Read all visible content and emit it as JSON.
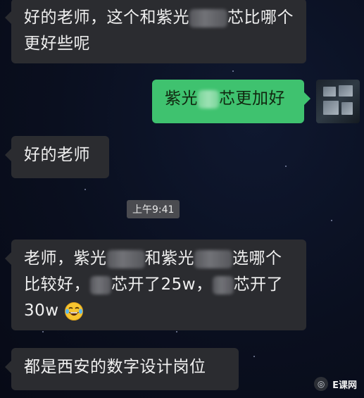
{
  "messages": [
    {
      "side": "left",
      "line1_a": "好的老师，这个和紫光",
      "line1_b": "芯比哪个",
      "line2": "更好些呢"
    },
    {
      "side": "right",
      "text_a": "紫光",
      "text_b": "芯更加好"
    },
    {
      "side": "left",
      "text": "好的老师"
    },
    {
      "timestamp": "上午9:41"
    },
    {
      "side": "left",
      "line1_a": "老师，紫光",
      "line1_b": "和紫光",
      "line1_c": "选哪个",
      "line2_a": "比较好，",
      "line2_b": "芯开了25w，",
      "line2_c": "芯开了",
      "line3": "30w"
    },
    {
      "side": "left",
      "text": "都是西安的数字设计岗位"
    }
  ],
  "watermark": {
    "icon": "wechat-channel-icon",
    "text": "E课网"
  },
  "colors": {
    "incoming_bubble": "#2b2c30",
    "outgoing_bubble": "#3fc26f",
    "background": "#0a0f1f"
  }
}
